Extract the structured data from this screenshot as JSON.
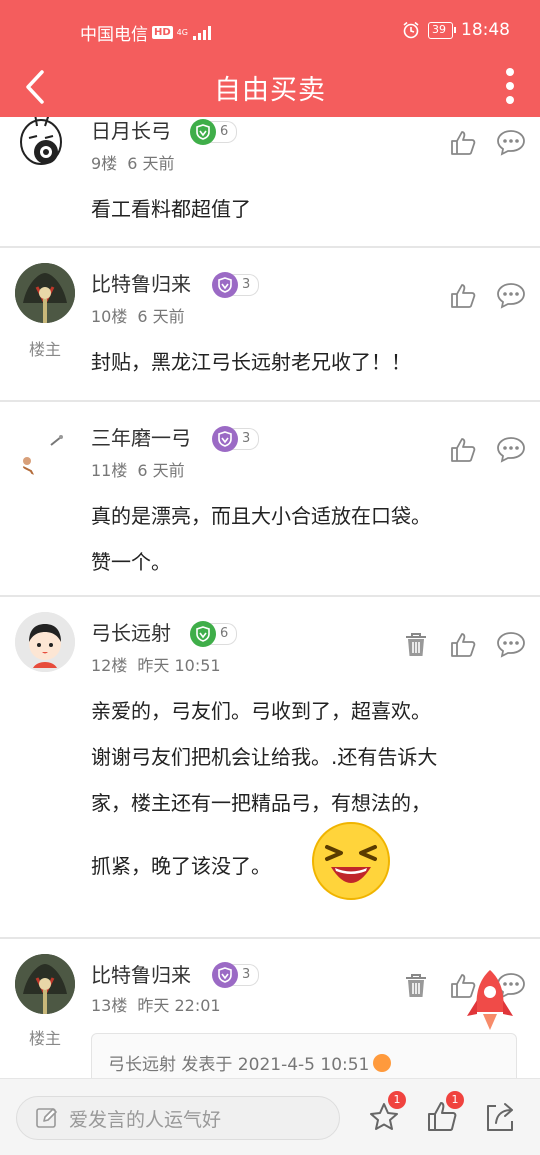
{
  "status_bar": {
    "carrier": "中国电信",
    "hd": "HD",
    "network": "4G",
    "battery": "39",
    "time": "18:48"
  },
  "nav": {
    "title": "自由买卖"
  },
  "posts": [
    {
      "username": "日月长弓",
      "level": "6",
      "floor": "9楼",
      "time": "6 天前",
      "body": [
        "看工看料都超值了"
      ]
    },
    {
      "username": "比特鲁归来",
      "level": "3",
      "floor": "10楼",
      "time": "6 天前",
      "owner_tag": "楼主",
      "body": [
        "封贴，黑龙江弓长远射老兄收了！！"
      ]
    },
    {
      "username": "三年磨一弓",
      "level": "3",
      "floor": "11楼",
      "time": "6 天前",
      "body": [
        "真的是漂亮，而且大小合适放在口袋。",
        "赞一个。"
      ]
    },
    {
      "username": "弓长远射",
      "level": "6",
      "floor": "12楼",
      "time": "昨天 10:51",
      "body": [
        "亲爱的，弓友们。弓收到了，超喜欢。",
        "谢谢弓友们把机会让给我。.还有告诉大",
        "家，楼主还有一把精品弓，有想法的，",
        "抓紧，晚了该没了。"
      ]
    },
    {
      "username": "比特鲁归来",
      "level": "3",
      "floor": "13楼",
      "time": "昨天 22:01",
      "owner_tag": "楼主",
      "quote": "弓长远射 发表于 2021-4-5 10:51"
    }
  ],
  "bottom_bar": {
    "input_placeholder": "爱发言的人运气好",
    "favorite_badge": "1",
    "like_badge": "1"
  }
}
